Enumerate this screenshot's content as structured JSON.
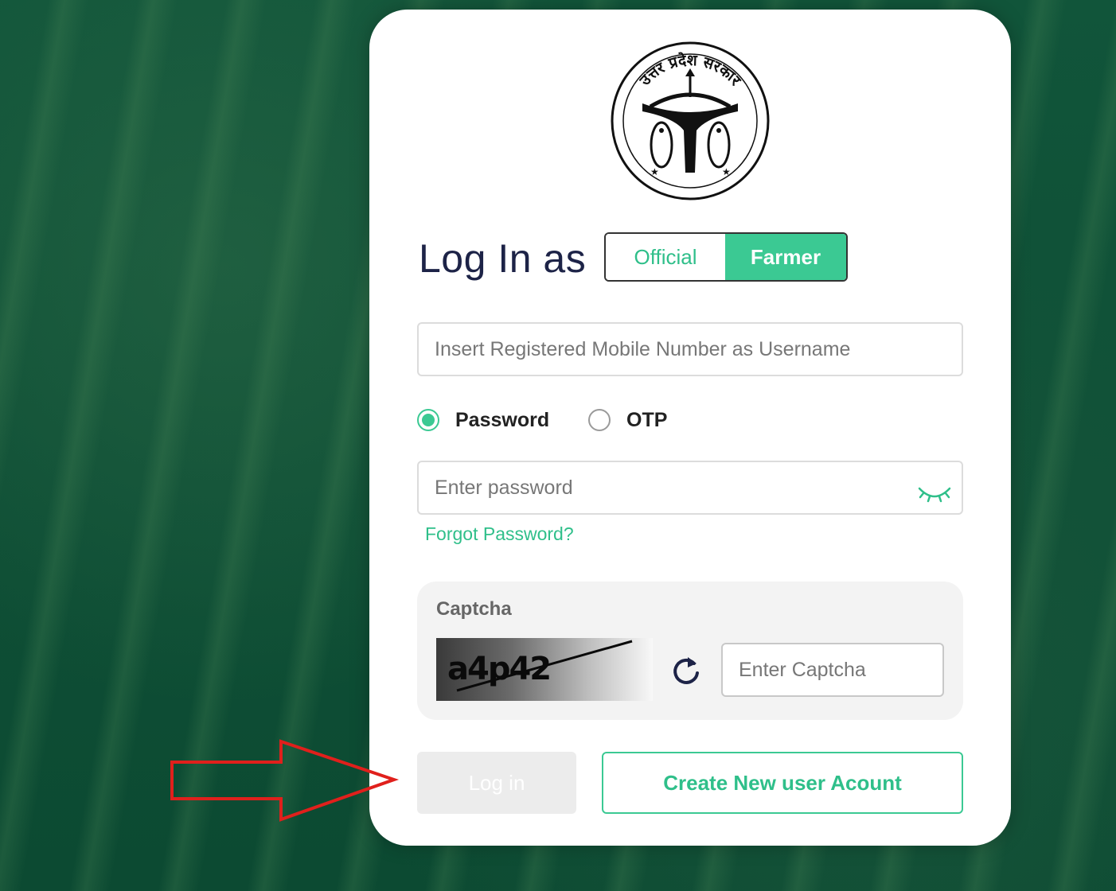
{
  "login": {
    "title": "Log In as",
    "roles": {
      "official": "Official",
      "farmer": "Farmer",
      "selected": "Farmer"
    },
    "username_placeholder": "Insert Registered Mobile Number as Username",
    "auth_methods": {
      "password": "Password",
      "otp": "OTP",
      "selected": "Password"
    },
    "password_placeholder": "Enter password",
    "forgot_password": "Forgot Password?",
    "captcha": {
      "label": "Captcha",
      "text": "a4p42",
      "input_placeholder": "Enter Captcha"
    },
    "login_button": "Log in",
    "create_account_button": "Create New user Acount"
  },
  "emblem": {
    "text": "उत्तर प्रदेश सरकार"
  },
  "colors": {
    "accent": "#3bc993",
    "accent_text": "#2fbf8a",
    "title": "#1d2347",
    "background": "#0f4d34",
    "annotation_arrow": "#e0201c"
  },
  "icons": {
    "eye": "eye-closed-icon",
    "refresh": "refresh-icon",
    "arrow": "arrow-right-annotation"
  }
}
